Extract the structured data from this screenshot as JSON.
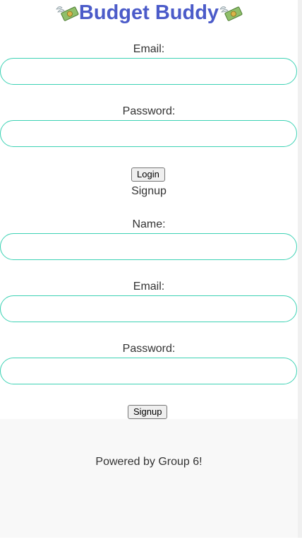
{
  "header": {
    "title": "Budget Buddy",
    "left_icon": "money-with-wings-icon",
    "right_icon": "money-with-wings-icon",
    "title_color": "#4b5bc9"
  },
  "login": {
    "email_label": "Email:",
    "email_value": "",
    "password_label": "Password:",
    "password_value": "",
    "button_label": "Login"
  },
  "signup": {
    "heading": "Signup",
    "name_label": "Name:",
    "name_value": "",
    "email_label": "Email:",
    "email_value": "",
    "password_label": "Password:",
    "password_value": "",
    "button_label": "Signup"
  },
  "footer": {
    "text": "Powered by Group 6!"
  },
  "colors": {
    "input_border": "#3dd2b4",
    "footer_bg": "#f8f8f8"
  }
}
